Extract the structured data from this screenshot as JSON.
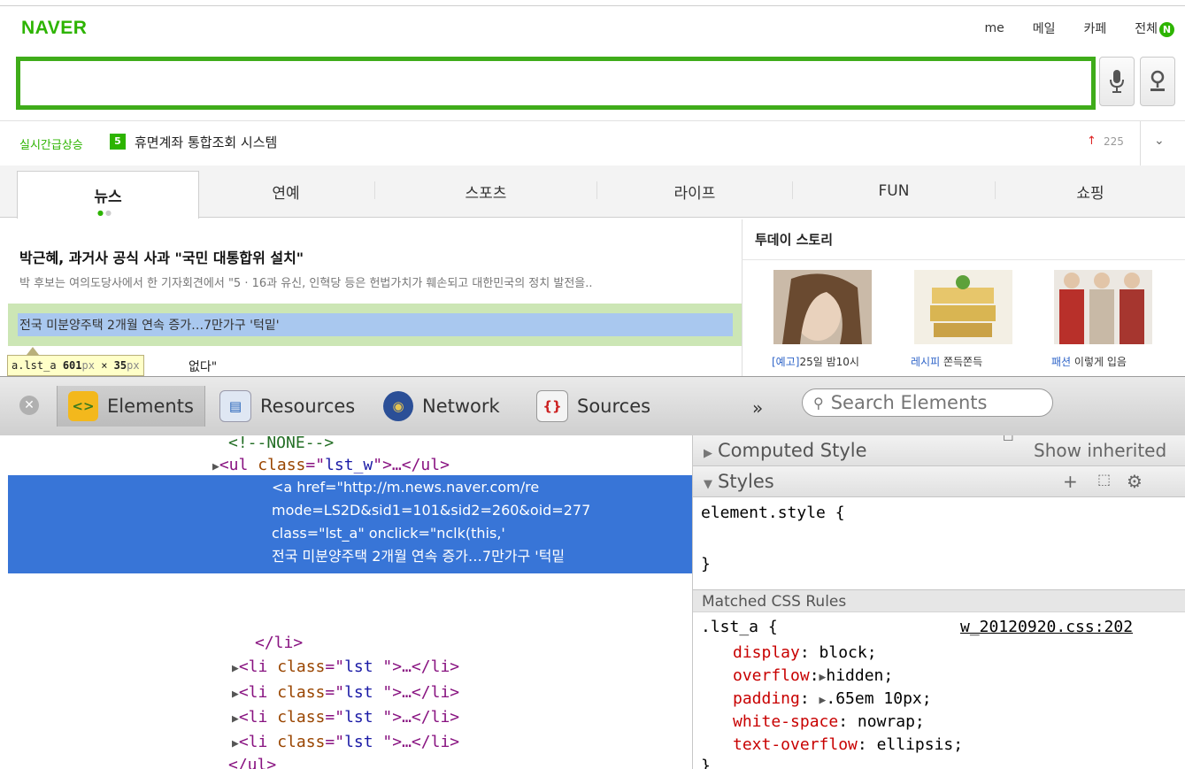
{
  "naver": {
    "logo": "NAVER",
    "top_links": [
      "me",
      "메일",
      "카페",
      "전체"
    ],
    "all_badge": "N",
    "search": {
      "value": "",
      "placeholder": ""
    },
    "realtime": {
      "label": "실시간급상승",
      "rank": "5",
      "text": "휴면계좌 통합조회 시스템",
      "trend_count": "225"
    },
    "tabs": [
      "뉴스",
      "연예",
      "스포츠",
      "라이프",
      "FUN",
      "쇼핑"
    ],
    "active_tab": "뉴스",
    "news": {
      "headline": "박근혜, 과거사 공식 사과 \"국민 대통합위 설치\"",
      "summary": "박 후보는 여의도당사에서 한 기자회견에서 \"5 · 16과 유신, 인혁당 등은 헌법가치가 훼손되고 대한민국의 정치 발전을..",
      "highlighted": "전국 미분양주택 2개월 연속 증가…7만가구 '턱밑'",
      "next_tail": "없다\""
    },
    "tooltip": {
      "selector": "a.lst_a",
      "width": "601",
      "height": "35",
      "unit": "px",
      "times": "×"
    },
    "today_story": {
      "title": "투데이 스토리",
      "items": [
        {
          "keyword": "[예고]",
          "text": "25일 밤10시"
        },
        {
          "keyword": "레시피",
          "text": "쫀득쫀득"
        },
        {
          "keyword": "패션",
          "text": "이렇게 입음"
        }
      ]
    }
  },
  "devtools": {
    "tabs": [
      "Elements",
      "Resources",
      "Network",
      "Sources"
    ],
    "active_tab": "Elements",
    "search_placeholder": "Search Elements",
    "more": "»",
    "dom": {
      "comment": "<!--NONE-->",
      "ul_collapsed": {
        "tag_open": "<ul ",
        "attr": "class",
        "eq": "=\"",
        "val": "lst_w",
        "close": "\">…</ul>"
      },
      "ul_open": {
        "tag_open": "<ul ",
        "attr": "class",
        "val": "lst_w"
      },
      "li_open": {
        "tag_open": "<li ",
        "attr": "class",
        "val": "lst "
      },
      "selected_lines": [
        "<a href=\"http://m.news.naver.com/re",
        "mode=LS2D&sid1=101&sid2=260&oid=277",
        "class=\"lst_a\" onclick=\"nclk(this,'",
        "전국 미분양주택 2개월 연속 증가…7만가구 '턱밑"
      ],
      "li_close": "</li>",
      "li_collapsed_count": 4,
      "li_collapsed_text": "<li class=\"lst \">…</li>",
      "ul_close": "</ul>"
    },
    "sidebar": {
      "computed_title": "Computed Style",
      "show_inherited": "Show inherited",
      "styles_title": "Styles",
      "element_style_open": "element.style {",
      "element_style_close": "}",
      "matched_title": "Matched CSS Rules",
      "rule_selector": ".lst_a {",
      "rule_source": "w_20120920.css:202",
      "declarations": [
        {
          "prop": "display",
          "value": "block;"
        },
        {
          "prop": "overflow",
          "value": "hidden;"
        },
        {
          "prop": "padding",
          "value": ".65em 10px;"
        },
        {
          "prop": "white-space",
          "value": "nowrap;"
        },
        {
          "prop": "text-overflow",
          "value": "ellipsis;"
        }
      ],
      "rule_close": "}"
    }
  },
  "colors": {
    "naver_green": "#2db400",
    "selection_blue": "#3875d7",
    "highlight_green": "#cce6b5",
    "highlight_blue": "#a9c8ef"
  }
}
